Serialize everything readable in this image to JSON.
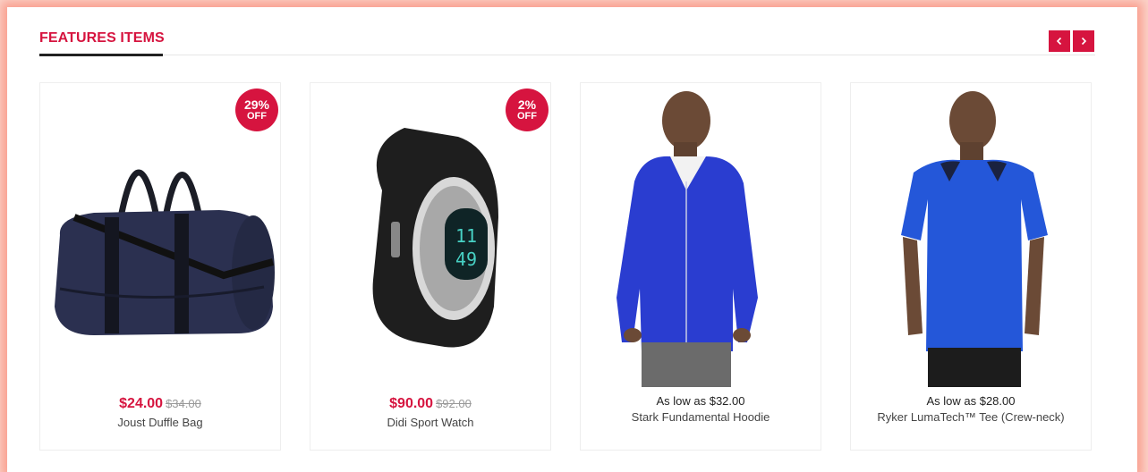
{
  "section": {
    "title": "FEATURES ITEMS"
  },
  "nav": {
    "prev_icon": "chevron-left-icon",
    "next_icon": "chevron-right-icon"
  },
  "colors": {
    "accent": "#d6143f",
    "frame_glow": "#f87864"
  },
  "products": [
    {
      "name": "Joust Duffle Bag",
      "price": "$24.00",
      "old_price": "$34.00",
      "badge_pct": "29%",
      "badge_off": "OFF",
      "image": "duffle-bag"
    },
    {
      "name": "Didi Sport Watch",
      "price": "$90.00",
      "old_price": "$92.00",
      "badge_pct": "2%",
      "badge_off": "OFF",
      "image": "sport-watch"
    },
    {
      "name": "Stark Fundamental Hoodie",
      "price_text": "As low as $32.00",
      "image": "hoodie"
    },
    {
      "name": "Ryker LumaTech™ Tee (Crew-neck)",
      "price_text": "As low as $28.00",
      "image": "tee"
    }
  ]
}
